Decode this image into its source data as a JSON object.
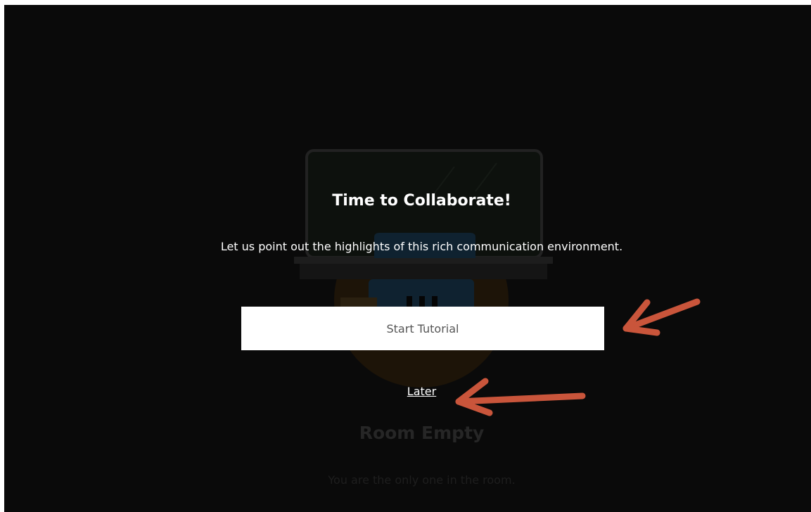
{
  "overlay": {
    "title": "Time to Collaborate!",
    "subtitle": "Let us point out the highlights of this rich communication environment.",
    "start_button_label": "Start Tutorial",
    "later_link_label": "Later"
  },
  "background": {
    "room_status_title": "Room Empty",
    "room_status_message": "You are the only one in the room."
  },
  "colors": {
    "backdrop": "#0a0a0a",
    "annotation_arrow": "#c9553b",
    "button_background": "#ffffff"
  }
}
